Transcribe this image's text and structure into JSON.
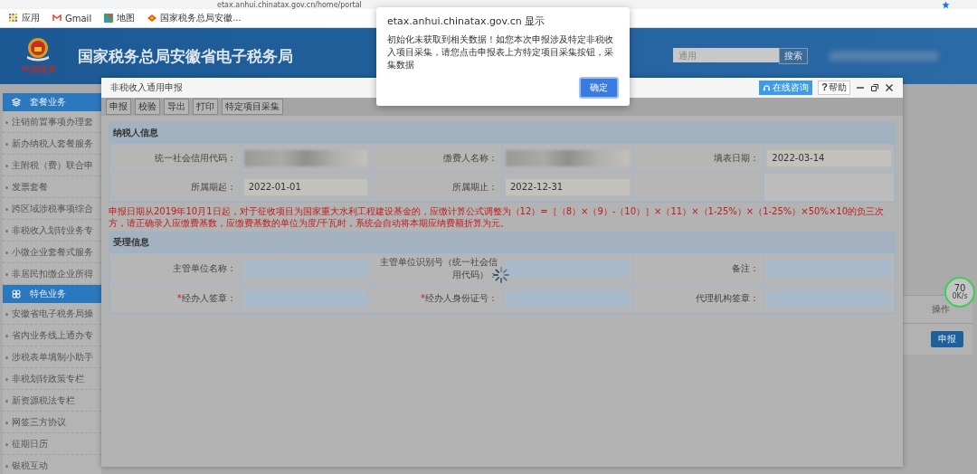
{
  "browser": {
    "address": "etax.anhui.chinatax.gov.cn/home/portal",
    "bookmarks": [
      {
        "label": "应用",
        "kind": "apps"
      },
      {
        "label": "Gmail",
        "kind": "gmail"
      },
      {
        "label": "地图",
        "kind": "maps"
      },
      {
        "label": "国家税务总局安徽...",
        "kind": "site"
      }
    ]
  },
  "header": {
    "logo_text": "中国税务",
    "title": "国家税务总局安徽省电子税务局",
    "search": {
      "placeholder": "通用",
      "button": "搜索"
    }
  },
  "sidebar": [
    {
      "title": "套餐业务",
      "kind": "stack",
      "items": [
        "注销前置事项办理套",
        "新办纳税人套餐服务",
        "主附税（费）联合申",
        "发票套餐",
        "跨区域涉税事项综合",
        "非税收入划转业务专",
        "小微企业套餐式服务",
        "非居民扣缴企业所得"
      ]
    },
    {
      "title": "特色业务",
      "kind": "flower",
      "items": [
        "安徽省电子税务局操",
        "省内业务线上通办专",
        "涉税表单填制小助手",
        "非税划转政策专栏",
        "新资源税法专栏",
        "网签三方协议",
        "征期日历",
        "银税互动"
      ]
    }
  ],
  "page_table": {
    "column": "操作",
    "action": "申报"
  },
  "speed_widget": {
    "value": "70",
    "rate": "0K/s"
  },
  "modal": {
    "title": "非税收入通用申报",
    "consult_button": "在线咨询",
    "help_glyph": "?",
    "help_button": "帮助",
    "toolbar": [
      "申报",
      "校验",
      "导出",
      "打印",
      "特定项目采集"
    ],
    "blocks": [
      {
        "kind": "section",
        "title": "纳税人信息",
        "rows": [
          [
            {
              "label": "统一社会信用代码：",
              "kind": "blurred"
            },
            {
              "label": "缴费人名称：",
              "kind": "blurred"
            },
            {
              "label": "填表日期：",
              "kind": "readonly",
              "value": "2022-03-14"
            }
          ],
          [
            {
              "label": "所属期起：",
              "kind": "readonly",
              "value": "2022-01-01"
            },
            {
              "label": "所属期止：",
              "kind": "readonly",
              "value": "2022-12-31"
            },
            {
              "kind": "blank"
            }
          ]
        ]
      },
      {
        "kind": "notice",
        "text": "申报日期从2019年10月1日起，对于征收项目为国家重大水利工程建设基金的，应缴计算公式调整为（12）=［（8）×（9）-（10）］×（11）×（1-25%）×（1-25%）×50%×10的负三次方，请正确录入应缴费基数，应缴费基数的单位为度/千瓦时，系统会自动将本期应纳费额折算为元。"
      },
      {
        "kind": "section",
        "title": "受理信息",
        "rows": [
          [
            {
              "label": "主管单位名称：",
              "kind": "editable"
            },
            {
              "label": "主管单位识别号（统一社会信用代码）：",
              "kind": "editable"
            },
            {
              "label": "备注：",
              "kind": "editable"
            }
          ],
          [
            {
              "required_mark": "*",
              "label": "经办人签章：",
              "kind": "editable"
            },
            {
              "required_mark": "*",
              "label": "经办人身份证号：",
              "kind": "editable"
            },
            {
              "label": "代理机构签章：",
              "kind": "editable"
            }
          ]
        ]
      }
    ]
  },
  "alert": {
    "title": "etax.anhui.chinatax.gov.cn 显示",
    "message": "初始化未获取到相关数据！如您本次申报涉及特定非税收入项目采集，请您点击申报表上方特定项目采集按钮，采集数据",
    "button": "确定"
  }
}
